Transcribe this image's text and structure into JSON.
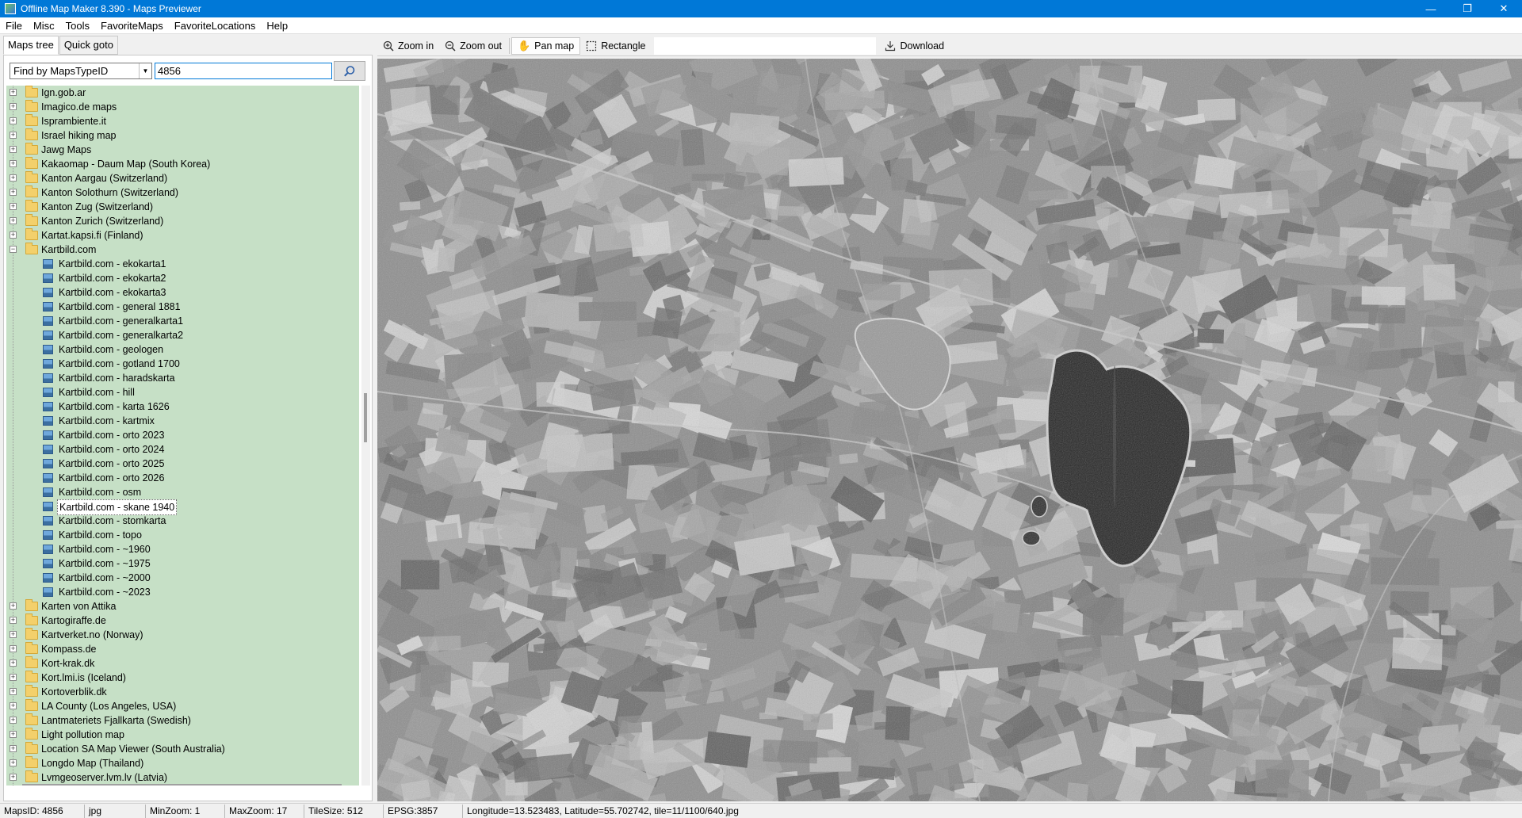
{
  "window": {
    "title": "Offline Map Maker 8.390 - Maps Previewer",
    "minimize": "—",
    "maximize": "❐",
    "close": "✕"
  },
  "menu": [
    "File",
    "Misc",
    "Tools",
    "FavoriteMaps",
    "FavoriteLocations",
    "Help"
  ],
  "tabs": {
    "maps_tree": "Maps tree",
    "quick_goto": "Quick goto"
  },
  "search": {
    "mode": "Find by MapsTypeID",
    "value": "4856"
  },
  "tree": [
    {
      "label": "Ign.gob.ar",
      "level": 0
    },
    {
      "label": "Imagico.de maps",
      "level": 0
    },
    {
      "label": "Isprambiente.it",
      "level": 0
    },
    {
      "label": "Israel hiking map",
      "level": 0
    },
    {
      "label": "Jawg Maps",
      "level": 0
    },
    {
      "label": "Kakaomap - Daum Map (South Korea)",
      "level": 0
    },
    {
      "label": "Kanton Aargau (Switzerland)",
      "level": 0
    },
    {
      "label": "Kanton Solothurn (Switzerland)",
      "level": 0
    },
    {
      "label": "Kanton Zug (Switzerland)",
      "level": 0
    },
    {
      "label": "Kanton Zurich (Switzerland)",
      "level": 0
    },
    {
      "label": "Kartat.kapsi.fi (Finland)",
      "level": 0
    },
    {
      "label": "Kartbild.com",
      "level": 0,
      "expanded": true
    },
    {
      "label": "Kartbild.com - ekokarta1",
      "level": 1
    },
    {
      "label": "Kartbild.com - ekokarta2",
      "level": 1
    },
    {
      "label": "Kartbild.com - ekokarta3",
      "level": 1
    },
    {
      "label": "Kartbild.com - general 1881",
      "level": 1
    },
    {
      "label": "Kartbild.com - generalkarta1",
      "level": 1
    },
    {
      "label": "Kartbild.com - generalkarta2",
      "level": 1
    },
    {
      "label": "Kartbild.com - geologen",
      "level": 1
    },
    {
      "label": "Kartbild.com - gotland 1700",
      "level": 1
    },
    {
      "label": "Kartbild.com - haradskarta",
      "level": 1
    },
    {
      "label": "Kartbild.com - hill",
      "level": 1
    },
    {
      "label": "Kartbild.com - karta 1626",
      "level": 1
    },
    {
      "label": "Kartbild.com - kartmix",
      "level": 1
    },
    {
      "label": "Kartbild.com - orto 2023",
      "level": 1
    },
    {
      "label": "Kartbild.com - orto 2024",
      "level": 1
    },
    {
      "label": "Kartbild.com - orto 2025",
      "level": 1
    },
    {
      "label": "Kartbild.com - orto 2026",
      "level": 1
    },
    {
      "label": "Kartbild.com - osm",
      "level": 1
    },
    {
      "label": "Kartbild.com - skane 1940",
      "level": 1,
      "selected": true
    },
    {
      "label": "Kartbild.com - stomkarta",
      "level": 1
    },
    {
      "label": "Kartbild.com - topo",
      "level": 1
    },
    {
      "label": "Kartbild.com - ~1960",
      "level": 1
    },
    {
      "label": "Kartbild.com - ~1975",
      "level": 1
    },
    {
      "label": "Kartbild.com - ~2000",
      "level": 1
    },
    {
      "label": "Kartbild.com - ~2023",
      "level": 1
    },
    {
      "label": "Karten von Attika",
      "level": 0
    },
    {
      "label": "Kartogiraffe.de",
      "level": 0
    },
    {
      "label": "Kartverket.no (Norway)",
      "level": 0
    },
    {
      "label": "Kompass.de",
      "level": 0
    },
    {
      "label": "Kort-krak.dk",
      "level": 0
    },
    {
      "label": "Kort.lmi.is (Iceland)",
      "level": 0
    },
    {
      "label": "Kortoverblik.dk",
      "level": 0
    },
    {
      "label": "LA County (Los Angeles, USA)",
      "level": 0
    },
    {
      "label": "Lantmateriets Fjallkarta (Swedish)",
      "level": 0
    },
    {
      "label": "Light pollution map",
      "level": 0
    },
    {
      "label": "Location SA Map Viewer (South Australia)",
      "level": 0
    },
    {
      "label": "Longdo Map (Thailand)",
      "level": 0
    },
    {
      "label": "Lvmgeoserver.lvm.lv (Latvia)",
      "level": 0
    }
  ],
  "toolbar": {
    "zoom_in": "Zoom in",
    "zoom_out": "Zoom out",
    "pan_map": "Pan map",
    "rectangle": "Rectangle",
    "download": "Download"
  },
  "status": {
    "maps_id": "MapsID: 4856",
    "format": "jpg",
    "min_zoom": "MinZoom: 1",
    "max_zoom": "MaxZoom: 17",
    "tile_size": "TileSize: 512",
    "epsg": "EPSG:3857",
    "coords": "Longitude=13.523483, Latitude=55.702742, tile=11/1100/640.jpg"
  },
  "icons": {
    "search": "magnifier-icon",
    "zoom_in": "zoom-in-icon",
    "zoom_out": "zoom-out-icon",
    "pan": "hand-icon",
    "rectangle": "rectangle-select-icon",
    "download": "download-icon"
  }
}
